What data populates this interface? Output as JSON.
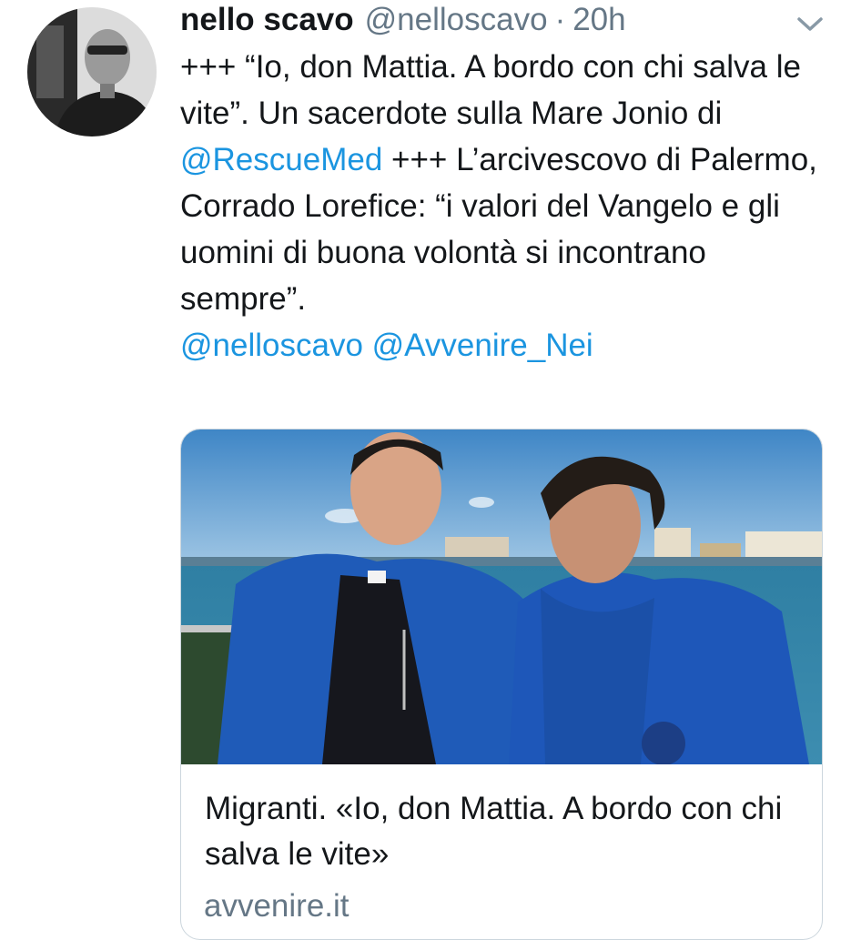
{
  "tweet": {
    "author_name": "nello scavo",
    "author_handle": "@nelloscavo",
    "separator": "·",
    "time": "20h",
    "text_part1": "+++ “Io, don Mattia. A bordo con chi salva le vite”.  Un sacerdote sulla Mare Jonio di ",
    "mention_rescuemed": "@RescueMed",
    "text_part2": " +++ L’arcivescovo di Palermo, Corrado Lorefice: “i valori del Vangelo e gli uomini di buona volontà si incontrano sempre”.",
    "mention_nelloscavo": "@nelloscavo",
    "mention_avvenire": "@Avvenire_Nei"
  },
  "card": {
    "title": "Migranti. «Io, don Mattia. A bordo con chi salva le vite»",
    "domain": "avvenire.it"
  },
  "icons": {
    "menu": "chevron-down-icon",
    "avatar": "avatar-photo"
  },
  "colors": {
    "link": "#1b95e0",
    "secondary_text": "#657786",
    "card_border": "#ccd6dd"
  }
}
